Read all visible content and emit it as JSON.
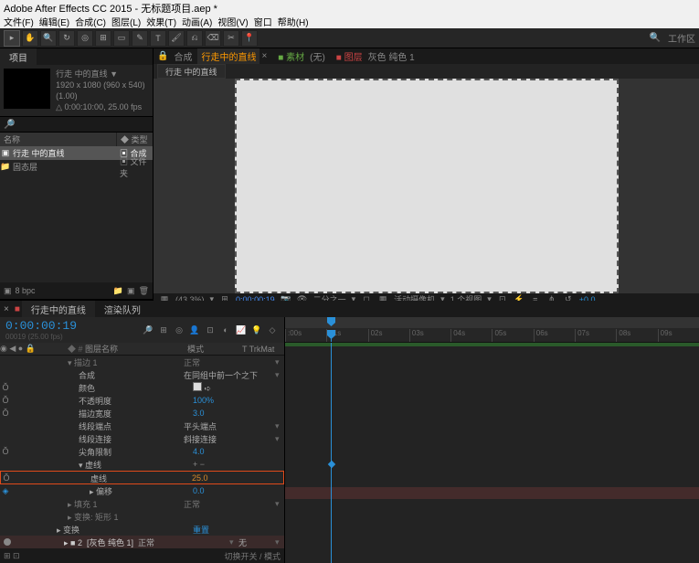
{
  "title": "Adobe After Effects CC 2015 - 无标题项目.aep *",
  "menu": [
    "文件(F)",
    "编辑(E)",
    "合成(C)",
    "图层(L)",
    "效果(T)",
    "动画(A)",
    "视图(V)",
    "窗口",
    "帮助(H)"
  ],
  "toolbar_right": "工作区",
  "project": {
    "tab": "项目",
    "comp_name": "行走 中的直线 ▼",
    "comp_meta1": "1920 x 1080  (960 x 540) (1.00)",
    "comp_meta2": "△ 0:00:10:00, 25.00 fps",
    "search_placeholder": "",
    "head_name": "名称",
    "head_type": "类型",
    "rows": [
      {
        "name": "行走 中的直线",
        "type": "合成",
        "sel": true
      },
      {
        "name": "固态层",
        "type": "文件夹",
        "sel": false
      }
    ],
    "bpc": "8 bpc"
  },
  "center": {
    "tabs": {
      "comp_label": "合成",
      "comp_name": "行走中的直线",
      "footage": "素材",
      "none": "(无)",
      "layer": "图层",
      "solid": "灰色 纯色 1"
    },
    "flow_tab": "行走 中的直线"
  },
  "viewer_bar": {
    "zoom": "(43.3%)",
    "time": "0:00:00:19",
    "res": "二分之一",
    "cam": "活动摄像机",
    "view": "1 个视图",
    "exp": "+0.0"
  },
  "timeline": {
    "tab_active": "行走中的直线",
    "tab_render": "渲染队列",
    "tc": "0:00:00:19",
    "tc_sub": "00019 (25.00 fps)",
    "col_name": "图层名称",
    "col_mode": "模式",
    "col_trk": "T  TrkMat",
    "ruler": [
      ":00s",
      "01s",
      "02s",
      "03s",
      "04s",
      "05s",
      "06s",
      "07s",
      "08s",
      "09s"
    ],
    "props": {
      "stroke_grp": "描边 1",
      "stroke_normal": "正常",
      "composite": "合成",
      "composite_val": "在同组中前一个之下",
      "color": "颜色",
      "opacity": "不透明度",
      "opacity_val": "100%",
      "width": "描边宽度",
      "width_val": "3.0",
      "linecap": "线段端点",
      "linecap_val": "平头端点",
      "linejoin": "线段连接",
      "linejoin_val": "斜接连接",
      "miter": "尖角限制",
      "miter_val": "4.0",
      "dash_grp": "虚线",
      "dash": "虚线",
      "dash_val": "25.0",
      "offset": "偏移",
      "offset_val": "0.0",
      "fill": "填充 1",
      "fill_normal": "正常",
      "transform_rect": "变换: 矩形 1",
      "transform": "变换",
      "transform_val": "重置",
      "layer2": "[灰色 纯色 1]",
      "layer2_mode": "正常",
      "layer2_trk": "无"
    },
    "bottom": "切换开关 / 模式"
  }
}
